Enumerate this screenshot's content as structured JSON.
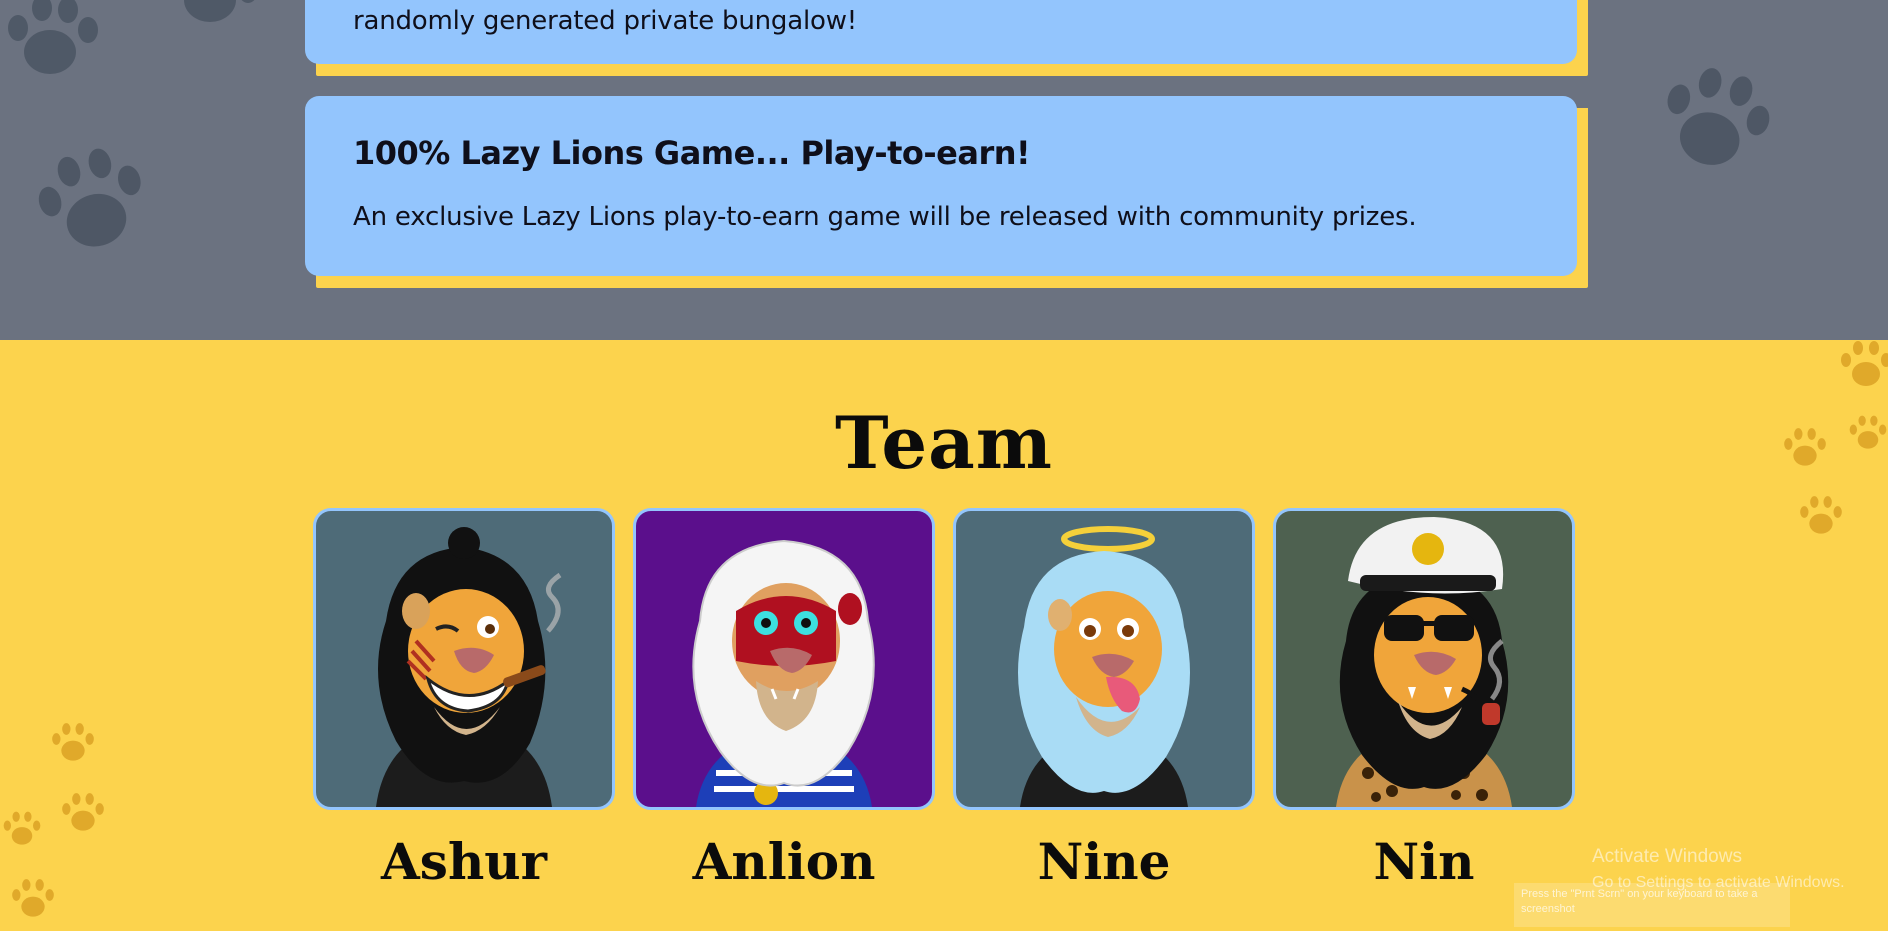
{
  "roadmap": {
    "cards": [
      {
        "title": "",
        "text": "randomly generated private bungalow!"
      },
      {
        "title": "100% Lazy Lions Game... Play-to-earn!",
        "text": "An exclusive Lazy Lions play-to-earn game will be released with community prizes."
      }
    ]
  },
  "team": {
    "heading": "Team",
    "members": [
      {
        "name": "Ashur",
        "background": "#4e6b78",
        "portrait_icon": "lion-winking-cigar-icon"
      },
      {
        "name": "Anlion",
        "background": "#5b0f8c",
        "portrait_icon": "lion-red-face-white-mane-icon"
      },
      {
        "name": "Nine",
        "background": "#4e6b78",
        "portrait_icon": "lion-halo-blue-mane-icon"
      },
      {
        "name": "Nin",
        "background": "#4e6150",
        "portrait_icon": "lion-captain-hat-sunglasses-icon"
      }
    ]
  },
  "windows_watermark": {
    "title": "Activate Windows",
    "subtitle": "Go to Settings to activate Windows.",
    "snip_tip": "Press the \"Prnt Scrn\" on your keyboard to take a screenshot"
  },
  "colors": {
    "roadmap_bg": "#6b7280",
    "card_bg": "#93c5fd",
    "card_shadow": "#fcd34d",
    "team_bg": "#fcd34d"
  }
}
